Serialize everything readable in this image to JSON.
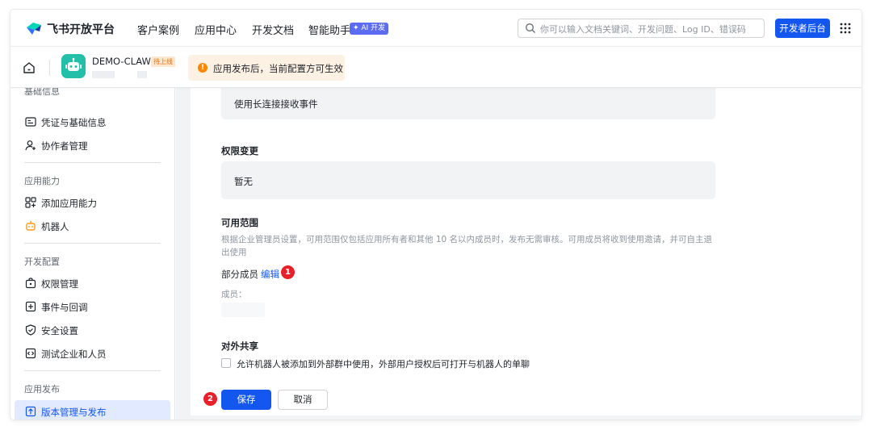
{
  "topnav": {
    "brand": "飞书开放平台",
    "links": [
      "客户案例",
      "应用中心",
      "开发文档",
      "智能助手"
    ],
    "ai_badge": "✦ AI 开发",
    "search_placeholder": "你可以输入文档关键词、开发问题、Log ID、错误码",
    "dev_button": "开发者后台"
  },
  "appbar": {
    "app_name": "DEMO-CLAW",
    "status_tag": "待上线",
    "notice_icon": "!",
    "notice": "应用发布后，当前配置方可生效"
  },
  "sidebar": {
    "partial_top": "基础信息",
    "items_basic": [
      "凭证与基础信息",
      "协作者管理"
    ],
    "section_capability": "应用能力",
    "items_capability": [
      "添加应用能力",
      "机器人"
    ],
    "section_dev": "开发配置",
    "items_dev": [
      "权限管理",
      "事件与回调",
      "安全设置",
      "测试企业和人员"
    ],
    "section_publish": "应用发布",
    "items_publish": [
      "版本管理与发布"
    ]
  },
  "main": {
    "event_box_text": "使用长连接接收事件",
    "permission_title": "权限变更",
    "permission_value": "暂无",
    "scope_title": "可用范围",
    "scope_desc": "根据企业管理员设置，可用范围仅包括应用所有者和其他 10 名以内成员时，发布无需审核。可用成员将收到使用邀请，并可自主退出使用",
    "partial_members": "部分成员",
    "edit_link": "编辑",
    "members_label": "成员：",
    "share_title": "对外共享",
    "share_checkbox": "允许机器人被添加到外部群中使用，外部用户授权后可打开与机器人的单聊",
    "step1": "1",
    "step2": "2",
    "save": "保存",
    "cancel": "取消"
  },
  "colors": {
    "accent": "#1456f0",
    "step_red": "#e8202a",
    "notice_bg": "#fdf1e4",
    "app_avatar": "#23bfa8"
  }
}
